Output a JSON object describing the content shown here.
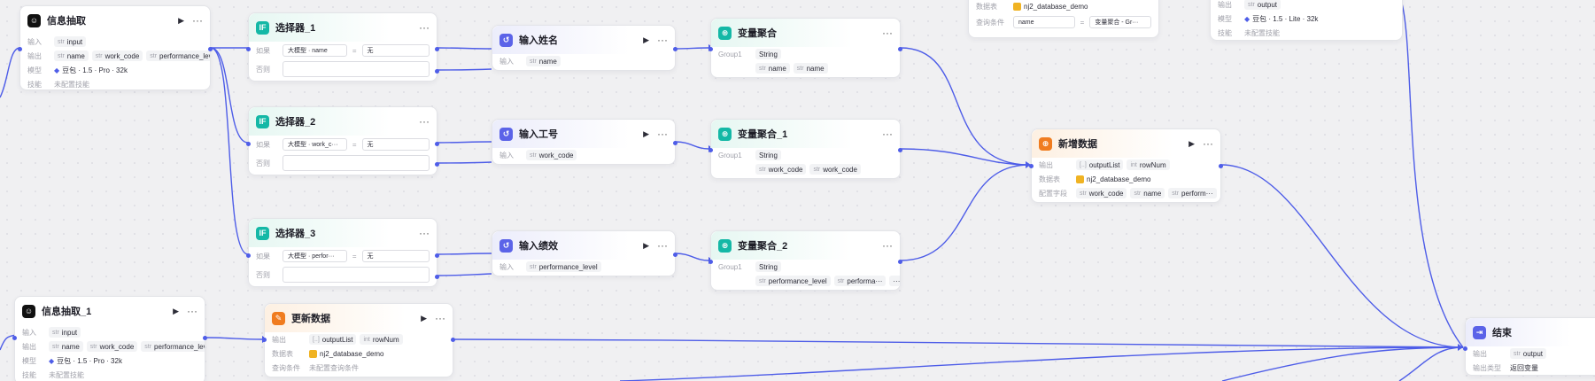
{
  "labels": {
    "input": "输入",
    "output": "输出",
    "model": "模型",
    "skill": "技能",
    "if": "如果",
    "else": "否则",
    "group1": "Group1",
    "database": "数据表",
    "query_cond": "查询条件",
    "config_field": "配置字段",
    "output_type": "输出类型",
    "eq": "=",
    "run_glyph": "▶",
    "more_glyph": "···",
    "ellipsis_tag": "···",
    "if_icon_text": "IF"
  },
  "nodes": {
    "extract": {
      "title": "信息抽取",
      "input": "input",
      "outputs": [
        "name",
        "work_code",
        "performance_level"
      ],
      "model": "豆包 · 1.5 · Pro · 32k",
      "skill": "未配置技能"
    },
    "sel1": {
      "title": "选择器_1",
      "left": "大模型",
      "field": "name",
      "right": "无"
    },
    "sel2": {
      "title": "选择器_2",
      "left": "大模型",
      "field": "work_c···",
      "right": "无"
    },
    "sel3": {
      "title": "选择器_3",
      "left": "大模型",
      "field": "perfor···",
      "right": "无"
    },
    "in_name": {
      "title": "输入姓名",
      "input": "name"
    },
    "in_code": {
      "title": "输入工号",
      "input": "work_code"
    },
    "in_perf": {
      "title": "输入绩效",
      "input": "performance_level"
    },
    "agg": {
      "title": "变量聚合",
      "type": "String",
      "vars": [
        "name",
        "name"
      ]
    },
    "agg1": {
      "title": "变量聚合_1",
      "type": "String",
      "vars": [
        "work_code",
        "work_code"
      ]
    },
    "agg2": {
      "title": "变量聚合_2",
      "type": "String",
      "vars": [
        "performance_level",
        "performa···"
      ]
    },
    "insert": {
      "title": "新增数据",
      "outputs": [
        "outputList",
        "rowNum"
      ],
      "db": "nj2_database_demo",
      "fields": [
        "work_code",
        "name",
        "perform···"
      ]
    },
    "extract1": {
      "title": "信息抽取_1",
      "input": "input",
      "outputs": [
        "name",
        "work_code",
        "performance_level"
      ],
      "model": "豆包 · 1.5 · Pro · 32k",
      "skill": "未配置技能"
    },
    "update": {
      "title": "更新数据",
      "outputs": [
        "outputList",
        "rowNum"
      ],
      "db": "nj2_database_demo",
      "cond": "未配置查询条件"
    },
    "end": {
      "title": "结束",
      "output": "output",
      "output_type": "返回变量"
    },
    "top_db": {
      "db": "nj2_database_demo",
      "cond_field": "name",
      "cond_val": "变量聚合 - Gr···"
    },
    "top_llm": {
      "output": "output",
      "model": "豆包 · 1.5 · Lite · 32k",
      "skill": "未配置技能"
    }
  },
  "type_tags": {
    "str": "str",
    "list": "[..]",
    "int": "int"
  },
  "colors": {
    "accent": "#4e5de8",
    "cyan": "#14b8a6",
    "indigo": "#5b63e8",
    "orange": "#f07c1f",
    "black": "#111111"
  }
}
